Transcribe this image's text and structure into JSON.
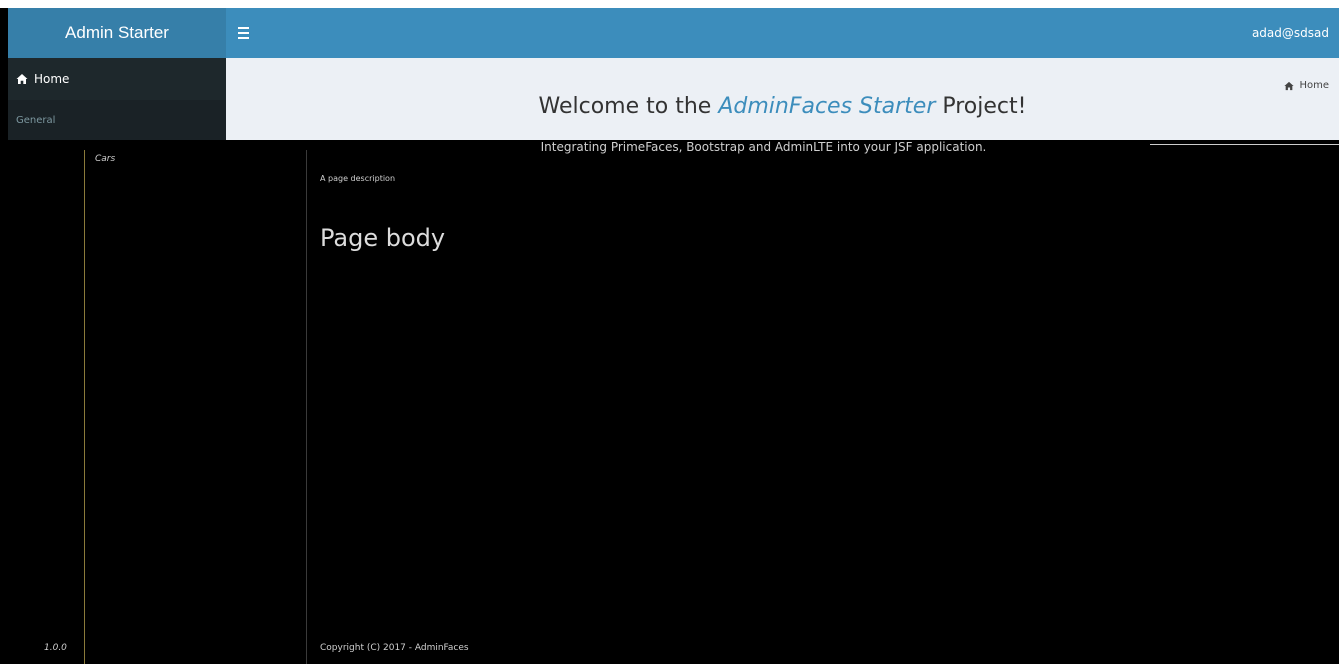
{
  "header": {
    "logo": "Admin Starter",
    "user": "adad@sdsad"
  },
  "sidebar": {
    "home_label": "Home",
    "section_header": "General",
    "cars_label": "Cars"
  },
  "content": {
    "title_prefix": "Welcome to the ",
    "title_accent": "AdminFaces Starter",
    "title_suffix": " Project!",
    "subtitle": "Integrating PrimeFaces, Bootstrap and AdminLTE into your JSF application.",
    "breadcrumb_home": "Home",
    "page_description": "A page description",
    "page_body": "Page body"
  },
  "footer": {
    "version": "1.0.0",
    "copyright": "Copyright (C) 2017 - AdminFaces"
  },
  "colors": {
    "logo_bg": "#367fa9",
    "navbar_bg": "#3c8dbc",
    "sidebar_bg": "#222d32",
    "accent": "#3c8dbc"
  }
}
